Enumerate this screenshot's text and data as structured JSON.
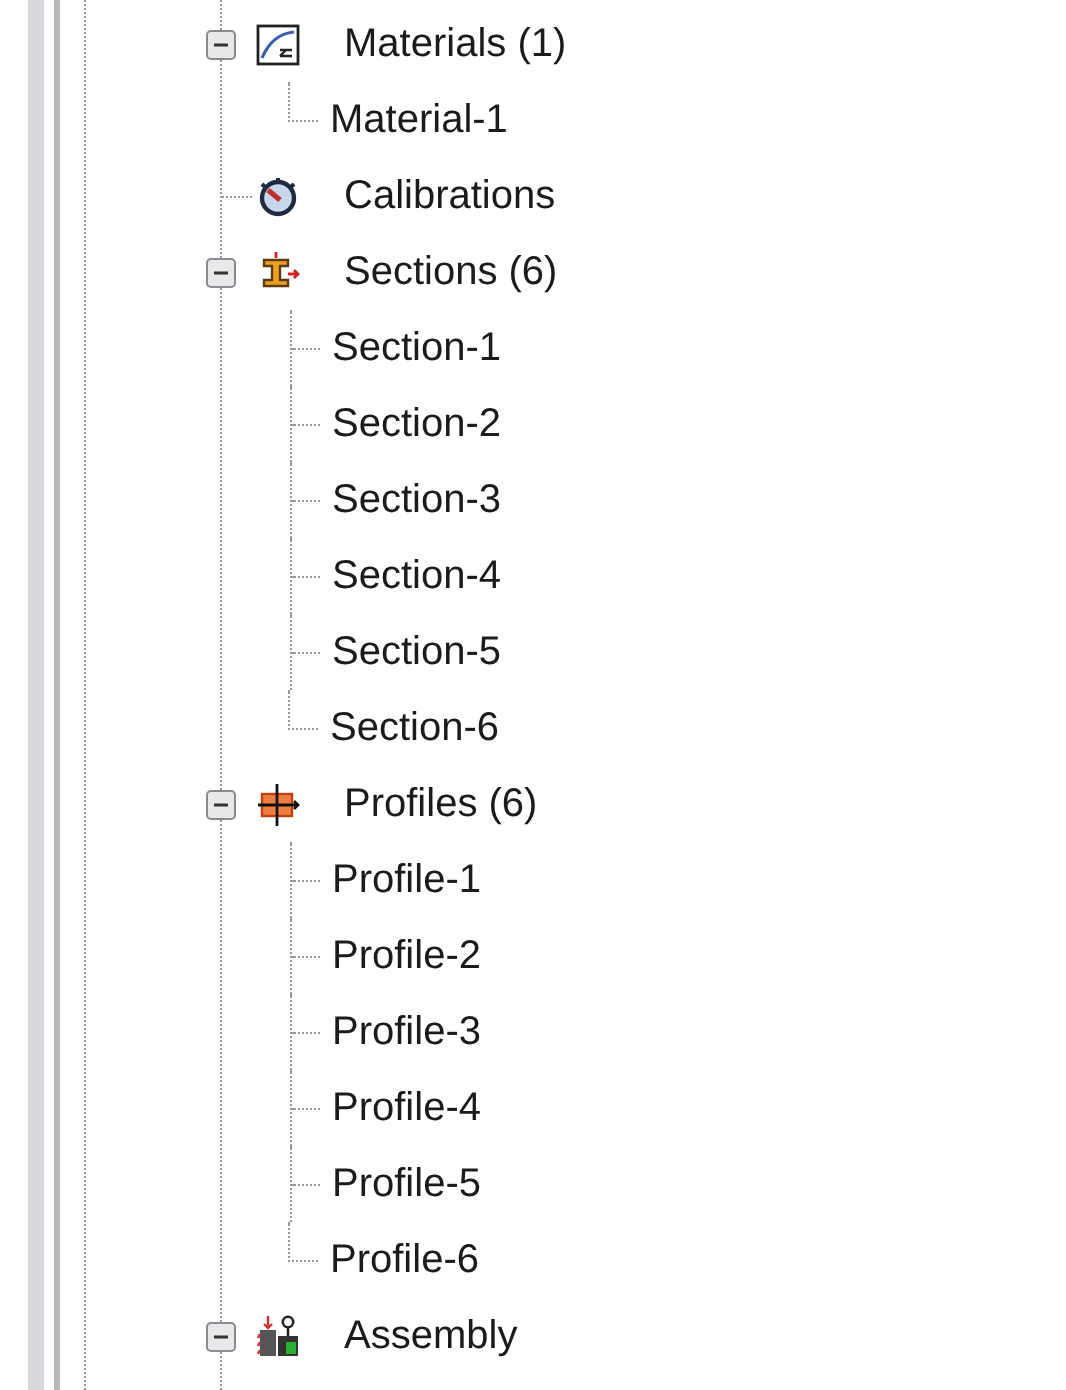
{
  "tree": [
    {
      "label": "Materials (1)",
      "kind": "materials",
      "expanded": true,
      "children": [
        {
          "label": "Material-1"
        }
      ]
    },
    {
      "label": "Calibrations",
      "kind": "calibrations"
    },
    {
      "label": "Sections (6)",
      "kind": "sections",
      "expanded": true,
      "children": [
        {
          "label": "Section-1"
        },
        {
          "label": "Section-2"
        },
        {
          "label": "Section-3"
        },
        {
          "label": "Section-4"
        },
        {
          "label": "Section-5"
        },
        {
          "label": "Section-6"
        }
      ]
    },
    {
      "label": "Profiles (6)",
      "kind": "profiles",
      "expanded": true,
      "children": [
        {
          "label": "Profile-1"
        },
        {
          "label": "Profile-2"
        },
        {
          "label": "Profile-3"
        },
        {
          "label": "Profile-4"
        },
        {
          "label": "Profile-5"
        },
        {
          "label": "Profile-6"
        }
      ]
    },
    {
      "label": "Assembly",
      "kind": "assembly",
      "expanded": true
    }
  ]
}
